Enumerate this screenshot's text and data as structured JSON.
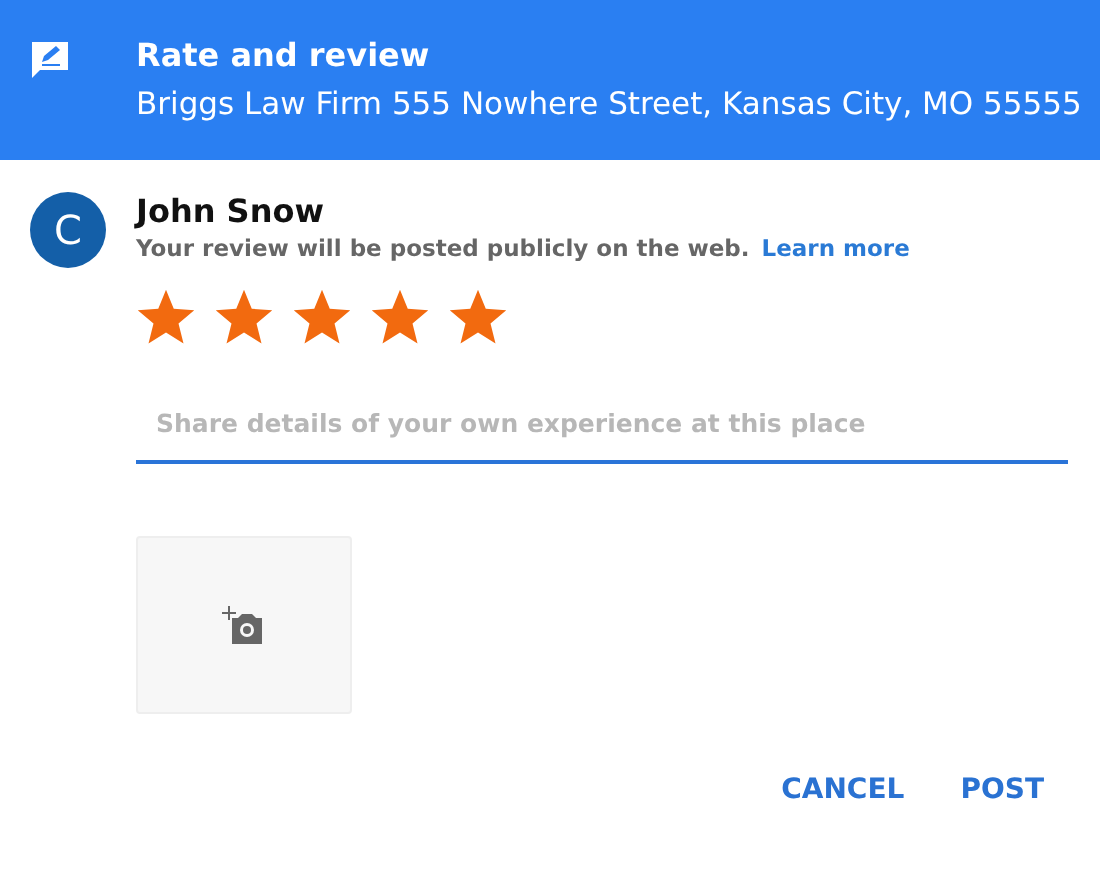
{
  "header": {
    "title": "Rate and review",
    "subtitle": "Briggs Law Firm 555 Nowhere Street, Kansas City, MO 55555"
  },
  "user": {
    "initial": "C",
    "name": "John Snow",
    "notice": "Your review will be posted publicly on the web.",
    "link": "Learn more"
  },
  "rating": {
    "stars": 5
  },
  "review": {
    "placeholder": "Share details of your own experience at this place"
  },
  "buttons": [
    "CANCEL",
    "POST"
  ]
}
